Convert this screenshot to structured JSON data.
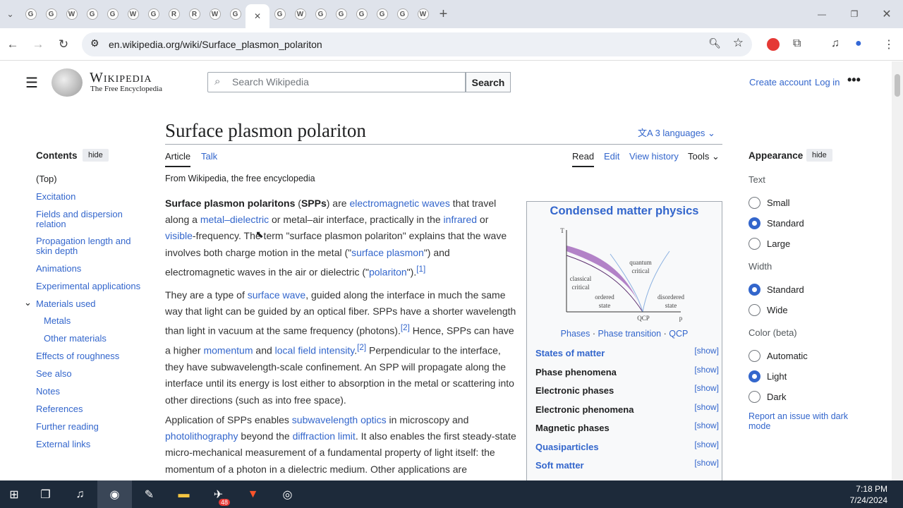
{
  "browser": {
    "tabs": [
      "G",
      "G",
      "W",
      "G",
      "G",
      "W",
      "G",
      "R",
      "R",
      "W",
      "G",
      "G",
      "W",
      "G",
      "G",
      "G",
      "G",
      "G",
      "W"
    ],
    "url": "en.wikipedia.org/wiki/Surface_plasmon_polariton"
  },
  "header": {
    "logo_title": "Wikipedia",
    "logo_sub": "The Free Encyclopedia",
    "search_placeholder": "Search Wikipedia",
    "search_button": "Search",
    "create_account": "Create account",
    "log_in": "Log in"
  },
  "article": {
    "title": "Surface plasmon polariton",
    "languages": "3 languages",
    "tabs": {
      "article": "Article",
      "talk": "Talk",
      "read": "Read",
      "edit": "Edit",
      "history": "View history",
      "tools": "Tools"
    },
    "from": "From Wikipedia, the free encyclopedia"
  },
  "toc": {
    "title": "Contents",
    "hide": "hide",
    "items": [
      "(Top)",
      "Excitation",
      "Fields and dispersion relation",
      "Propagation length and skin depth",
      "Animations",
      "Experimental applications",
      "Materials used",
      "Metals",
      "Other materials",
      "Effects of roughness",
      "See also",
      "Notes",
      "References",
      "Further reading",
      "External links"
    ]
  },
  "infobox": {
    "title": "Condensed matter physics",
    "diagram_labels": {
      "t": "T",
      "p": "p",
      "qcp": "QCP",
      "quantum": "quantum",
      "critical": "critical",
      "classical": "classical",
      "classical2": "critical",
      "ordered": "ordered",
      "state": "state",
      "disordered": "disordered",
      "state2": "state"
    },
    "links": [
      "Phases",
      "Phase transition",
      "QCP"
    ],
    "rows": [
      {
        "label": "States of matter",
        "link": true
      },
      {
        "label": "Phase phenomena",
        "link": false
      },
      {
        "label": "Electronic phases",
        "link": false
      },
      {
        "label": "Electronic phenomena",
        "link": false
      },
      {
        "label": "Magnetic phases",
        "link": false
      },
      {
        "label": "Quasiparticles",
        "link": true
      },
      {
        "label": "Soft matter",
        "link": true
      }
    ],
    "show": "[show]"
  },
  "appearance": {
    "title": "Appearance",
    "hide": "hide",
    "text": "Text",
    "text_opts": [
      "Small",
      "Standard",
      "Large"
    ],
    "text_selected": "Standard",
    "width": "Width",
    "width_opts": [
      "Standard",
      "Wide"
    ],
    "width_selected": "Standard",
    "color": "Color (beta)",
    "color_opts": [
      "Automatic",
      "Light",
      "Dark"
    ],
    "color_selected": "Light",
    "report": "Report an issue with dark mode"
  },
  "taskbar": {
    "time": "7:18 PM",
    "date": "7/24/2024",
    "badge": "48"
  },
  "colors": {
    "link": "#3366cc",
    "accent_purple": "#9b59b6"
  }
}
